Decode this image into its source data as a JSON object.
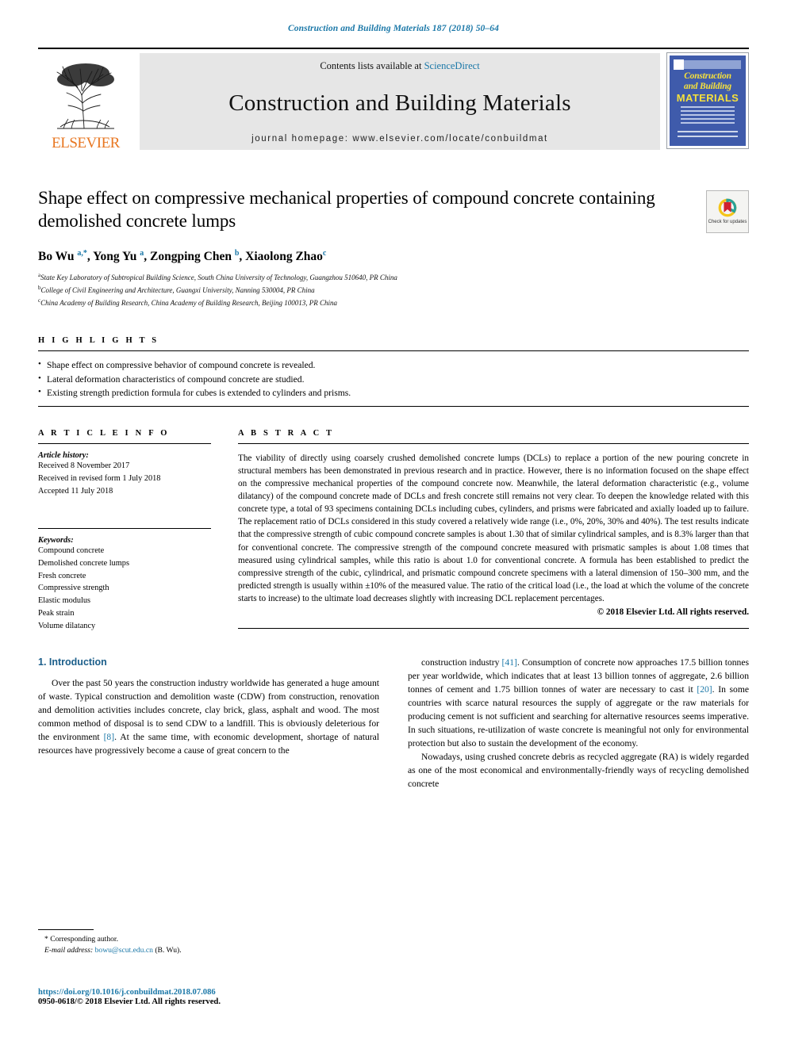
{
  "running_head": "Construction and Building Materials 187 (2018) 50–64",
  "masthead": {
    "publisher": "ELSEVIER",
    "contents_prefix": "Contents lists available at ",
    "contents_link": "ScienceDirect",
    "journal_name": "Construction and Building Materials",
    "homepage": "journal homepage: www.elsevier.com/locate/conbuildmat",
    "cover": {
      "line1": "Construction",
      "line2": "and Building",
      "line3": "MATERIALS"
    }
  },
  "article": {
    "title": "Shape effect on compressive mechanical properties of compound concrete containing demolished concrete lumps",
    "authors_html": "Bo Wu <sup>a,*</sup>, Yong Yu <sup>a</sup>, Zongping Chen <sup>b</sup>, Xiaolong Zhao<sup>c</sup>",
    "affiliations": [
      {
        "marker": "a",
        "text": "State Key Laboratory of Subtropical Building Science, South China University of Technology, Guangzhou 510640, PR China"
      },
      {
        "marker": "b",
        "text": "College of Civil Engineering and Architecture, Guangxi University, Nanning 530004, PR China"
      },
      {
        "marker": "c",
        "text": "China Academy of Building Research, China Academy of Building Research, Beijing 100013, PR China"
      }
    ],
    "crossmark_label": "Check for updates"
  },
  "highlights": {
    "heading": "H I G H L I G H T S",
    "items": [
      "Shape effect on compressive behavior of compound concrete is revealed.",
      "Lateral deformation characteristics of compound concrete are studied.",
      "Existing strength prediction formula for cubes is extended to cylinders and prisms."
    ]
  },
  "article_info": {
    "heading": "A R T I C L E   I N F O",
    "history_label": "Article history:",
    "history": [
      "Received 8 November 2017",
      "Received in revised form 1 July 2018",
      "Accepted 11 July 2018"
    ],
    "keywords_label": "Keywords:",
    "keywords": [
      "Compound concrete",
      "Demolished concrete lumps",
      "Fresh concrete",
      "Compressive strength",
      "Elastic modulus",
      "Peak strain",
      "Volume dilatancy"
    ]
  },
  "abstract": {
    "heading": "A B S T R A C T",
    "text": "The viability of directly using coarsely crushed demolished concrete lumps (DCLs) to replace a portion of the new pouring concrete in structural members has been demonstrated in previous research and in practice. However, there is no information focused on the shape effect on the compressive mechanical properties of the compound concrete now. Meanwhile, the lateral deformation characteristic (e.g., volume dilatancy) of the compound concrete made of DCLs and fresh concrete still remains not very clear. To deepen the knowledge related with this concrete type, a total of 93 specimens containing DCLs including cubes, cylinders, and prisms were fabricated and axially loaded up to failure. The replacement ratio of DCLs considered in this study covered a relatively wide range (i.e., 0%, 20%, 30% and 40%). The test results indicate that the compressive strength of cubic compound concrete samples is about 1.30 that of similar cylindrical samples, and is 8.3% larger than that for conventional concrete. The compressive strength of the compound concrete measured with prismatic samples is about 1.08 times that measured using cylindrical samples, while this ratio is about 1.0 for conventional concrete. A formula has been established to predict the compressive strength of the cubic, cylindrical, and prismatic compound concrete specimens with a lateral dimension of 150–300 mm, and the predicted strength is usually within ±10% of the measured value. The ratio of the critical load (i.e., the load at which the volume of the concrete starts to increase) to the ultimate load decreases slightly with increasing DCL replacement percentages.",
    "copyright": "© 2018 Elsevier Ltd. All rights reserved."
  },
  "body": {
    "section_title": "1. Introduction",
    "left_paragraphs": [
      "Over the past 50 years the construction industry worldwide has generated a huge amount of waste. Typical construction and demolition waste (CDW) from construction, renovation and demolition activities includes concrete, clay brick, glass, asphalt and wood. The most common method of disposal is to send CDW to a landfill. This is obviously deleterious for the environment [8]. At the same time, with economic development, shortage of natural resources have progressively become a cause of great concern to the"
    ],
    "right_paragraphs": [
      "construction industry [41]. Consumption of concrete now approaches 17.5 billion tonnes per year worldwide, which indicates that at least 13 billion tonnes of aggregate, 2.6 billion tonnes of cement and 1.75 billion tonnes of water are necessary to cast it [20]. In some countries with scarce natural resources the supply of aggregate or the raw materials for producing cement is not sufficient and searching for alternative resources seems imperative. In such situations, re-utilization of waste concrete is meaningful not only for environmental protection but also to sustain the development of the economy.",
      "Nowadays, using crushed concrete debris as recycled aggregate (RA) is widely regarded as one of the most economical and environmentally-friendly ways of recycling demolished concrete"
    ]
  },
  "footnote": {
    "corresponding": "* Corresponding author.",
    "email_label": "E-mail address:",
    "email": "bowu@scut.edu.cn",
    "email_suffix": "(B. Wu)."
  },
  "footer": {
    "doi": "https://doi.org/10.1016/j.conbuildmat.2018.07.086",
    "issn_line": "0950-0618/© 2018 Elsevier Ltd. All rights reserved."
  },
  "colors": {
    "link_blue": "#1b78a8",
    "elsevier_orange": "#e87722",
    "cover_blue": "#3f5bab",
    "cover_yellow": "#f5e03c"
  }
}
